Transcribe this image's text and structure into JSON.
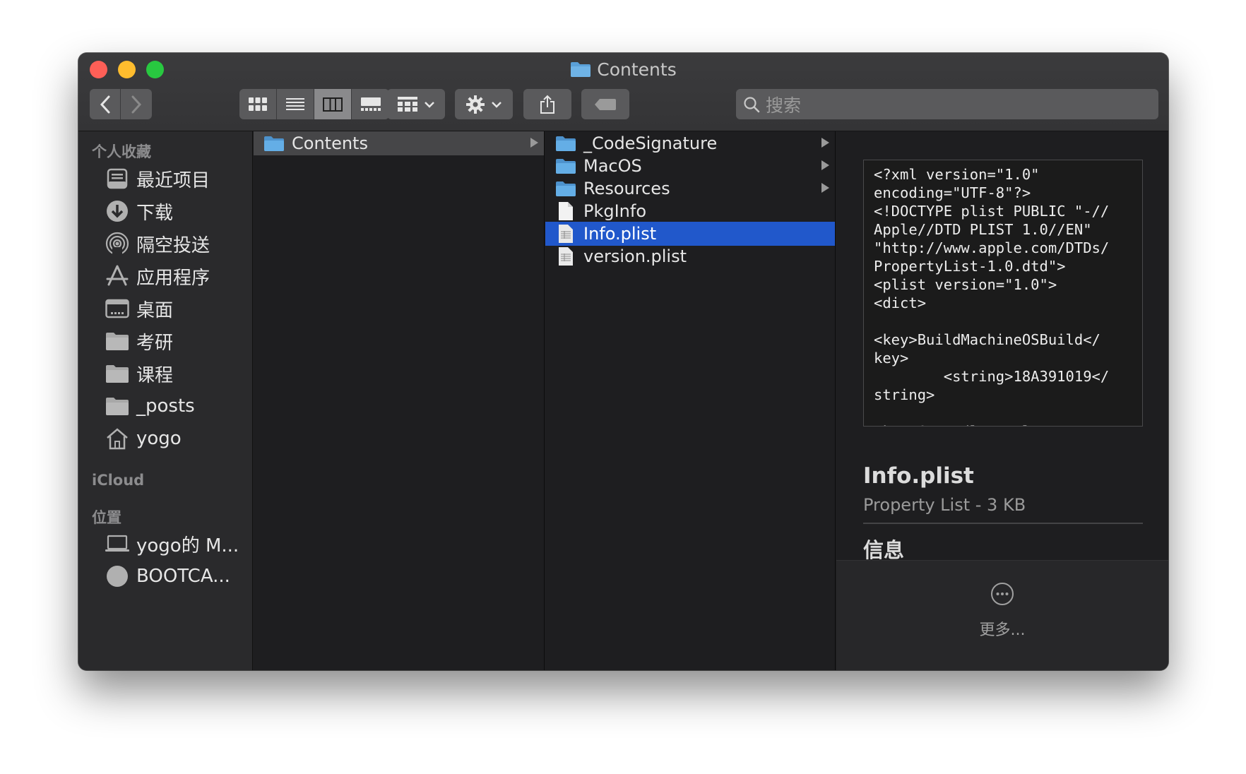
{
  "window": {
    "title": "Contents"
  },
  "toolbar": {
    "back_icon": "chevron-left-icon",
    "forward_icon": "chevron-right-icon",
    "view_modes": [
      "icon-view",
      "list-view",
      "column-view",
      "gallery-view"
    ],
    "active_view": "column-view",
    "search": {
      "placeholder": "搜索",
      "value": ""
    }
  },
  "sidebar": {
    "favorites_header": "个人收藏",
    "favorites": [
      {
        "label": "最近项目",
        "icon": "recents-icon"
      },
      {
        "label": "下载",
        "icon": "download-icon"
      },
      {
        "label": "隔空投送",
        "icon": "airdrop-icon"
      },
      {
        "label": "应用程序",
        "icon": "applications-icon"
      },
      {
        "label": "桌面",
        "icon": "desktop-icon"
      },
      {
        "label": "考研",
        "icon": "folder-icon"
      },
      {
        "label": "课程",
        "icon": "folder-icon"
      },
      {
        "label": "_posts",
        "icon": "folder-icon"
      },
      {
        "label": "yogo",
        "icon": "home-icon"
      }
    ],
    "icloud_header": "iCloud",
    "locations_header": "位置",
    "locations": [
      {
        "label": "yogo的 M...",
        "icon": "laptop-icon"
      },
      {
        "label": "BOOTCA...",
        "icon": "disk-icon"
      }
    ]
  },
  "columns": {
    "col1": [
      {
        "label": "Contents",
        "type": "folder",
        "has_children": true
      }
    ],
    "col2": [
      {
        "label": "_CodeSignature",
        "type": "folder",
        "has_children": true
      },
      {
        "label": "MacOS",
        "type": "folder",
        "has_children": true
      },
      {
        "label": "Resources",
        "type": "folder",
        "has_children": true
      },
      {
        "label": "PkgInfo",
        "type": "file",
        "has_children": false
      },
      {
        "label": "Info.plist",
        "type": "plist",
        "has_children": false,
        "selected": true
      },
      {
        "label": "version.plist",
        "type": "plist",
        "has_children": false
      }
    ]
  },
  "preview": {
    "plist_text": "<?xml version=\"1.0\"\nencoding=\"UTF-8\"?>\n<!DOCTYPE plist PUBLIC \"-//\nApple//DTD PLIST 1.0//EN\"\n\"http://www.apple.com/DTDs/\nPropertyList-1.0.dtd\">\n<plist version=\"1.0\">\n<dict>\n\n<key>BuildMachineOSBuild</\nkey>\n        <string>18A391019</\nstring>\n\n<key>CFBundleDevelopmentReg",
    "file_name": "Info.plist",
    "file_kind": "Property List - 3 KB",
    "info_header": "信息",
    "more_label": "更多..."
  },
  "colors": {
    "selection": "#2158cb",
    "folder": "#5aa0d8",
    "close": "#fe5f57",
    "minimize": "#febc2e",
    "zoom": "#28c840"
  }
}
